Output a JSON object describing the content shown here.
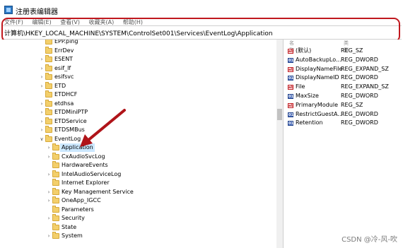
{
  "window": {
    "title": "注册表编辑器"
  },
  "menu": [
    "文件(F)",
    "编辑(E)",
    "查看(V)",
    "收藏夹(A)",
    "帮助(H)"
  ],
  "address": "计算机\\HKEY_LOCAL_MACHINE\\SYSTEM\\ControlSet001\\Services\\EventLog\\Application",
  "tree": {
    "items": [
      {
        "label": "EPP.ping",
        "expandable": false
      },
      {
        "label": "ErrDev",
        "expandable": false
      },
      {
        "label": "ESENT",
        "expandable": true
      },
      {
        "label": "esif_lf",
        "expandable": true
      },
      {
        "label": "esifsvc",
        "expandable": true
      },
      {
        "label": "ETD",
        "expandable": true
      },
      {
        "label": "ETDHCF",
        "expandable": false
      },
      {
        "label": "etdhsa",
        "expandable": true
      },
      {
        "label": "ETDMiniPTP",
        "expandable": true
      },
      {
        "label": "ETDService",
        "expandable": true
      },
      {
        "label": "ETDSMBus",
        "expandable": true
      },
      {
        "label": "EventLog",
        "expandable": true,
        "expanded": true
      },
      {
        "label": "Application",
        "expandable": true,
        "selected": true
      },
      {
        "label": "CxAudioSvcLog",
        "expandable": true
      },
      {
        "label": "HardwareEvents",
        "expandable": false
      },
      {
        "label": "IntelAudioServiceLog",
        "expandable": true
      },
      {
        "label": "Internet Explorer",
        "expandable": false
      },
      {
        "label": "Key Management Service",
        "expandable": true
      },
      {
        "label": "OneApp_IGCC",
        "expandable": true
      },
      {
        "label": "Parameters",
        "expandable": false
      },
      {
        "label": "Security",
        "expandable": true
      },
      {
        "label": "State",
        "expandable": false
      },
      {
        "label": "System",
        "expandable": true
      }
    ]
  },
  "values": {
    "header_name": "名称",
    "header_type": "类型",
    "rows": [
      {
        "name": "(默认)",
        "type": "REG_SZ",
        "icon": "sz"
      },
      {
        "name": "AutoBackupLo...",
        "type": "REG_DWORD",
        "icon": "dw"
      },
      {
        "name": "DisplayNameFile",
        "type": "REG_EXPAND_SZ",
        "icon": "sz"
      },
      {
        "name": "DisplayNameID",
        "type": "REG_DWORD",
        "icon": "dw"
      },
      {
        "name": "File",
        "type": "REG_EXPAND_SZ",
        "icon": "sz"
      },
      {
        "name": "MaxSize",
        "type": "REG_DWORD",
        "icon": "dw"
      },
      {
        "name": "PrimaryModule",
        "type": "REG_SZ",
        "icon": "sz"
      },
      {
        "name": "RestrictGuestA...",
        "type": "REG_DWORD",
        "icon": "dw"
      },
      {
        "name": "Retention",
        "type": "REG_DWORD",
        "icon": "dw"
      }
    ]
  },
  "icon_labels": {
    "sz": "ab",
    "dw": "011"
  },
  "colors": {
    "highlight": "#c0181e",
    "arrow": "#b01419",
    "selection": "#cce8ff",
    "folder": "#f3cf6b"
  },
  "watermark": "CSDN @冷-风-吹"
}
